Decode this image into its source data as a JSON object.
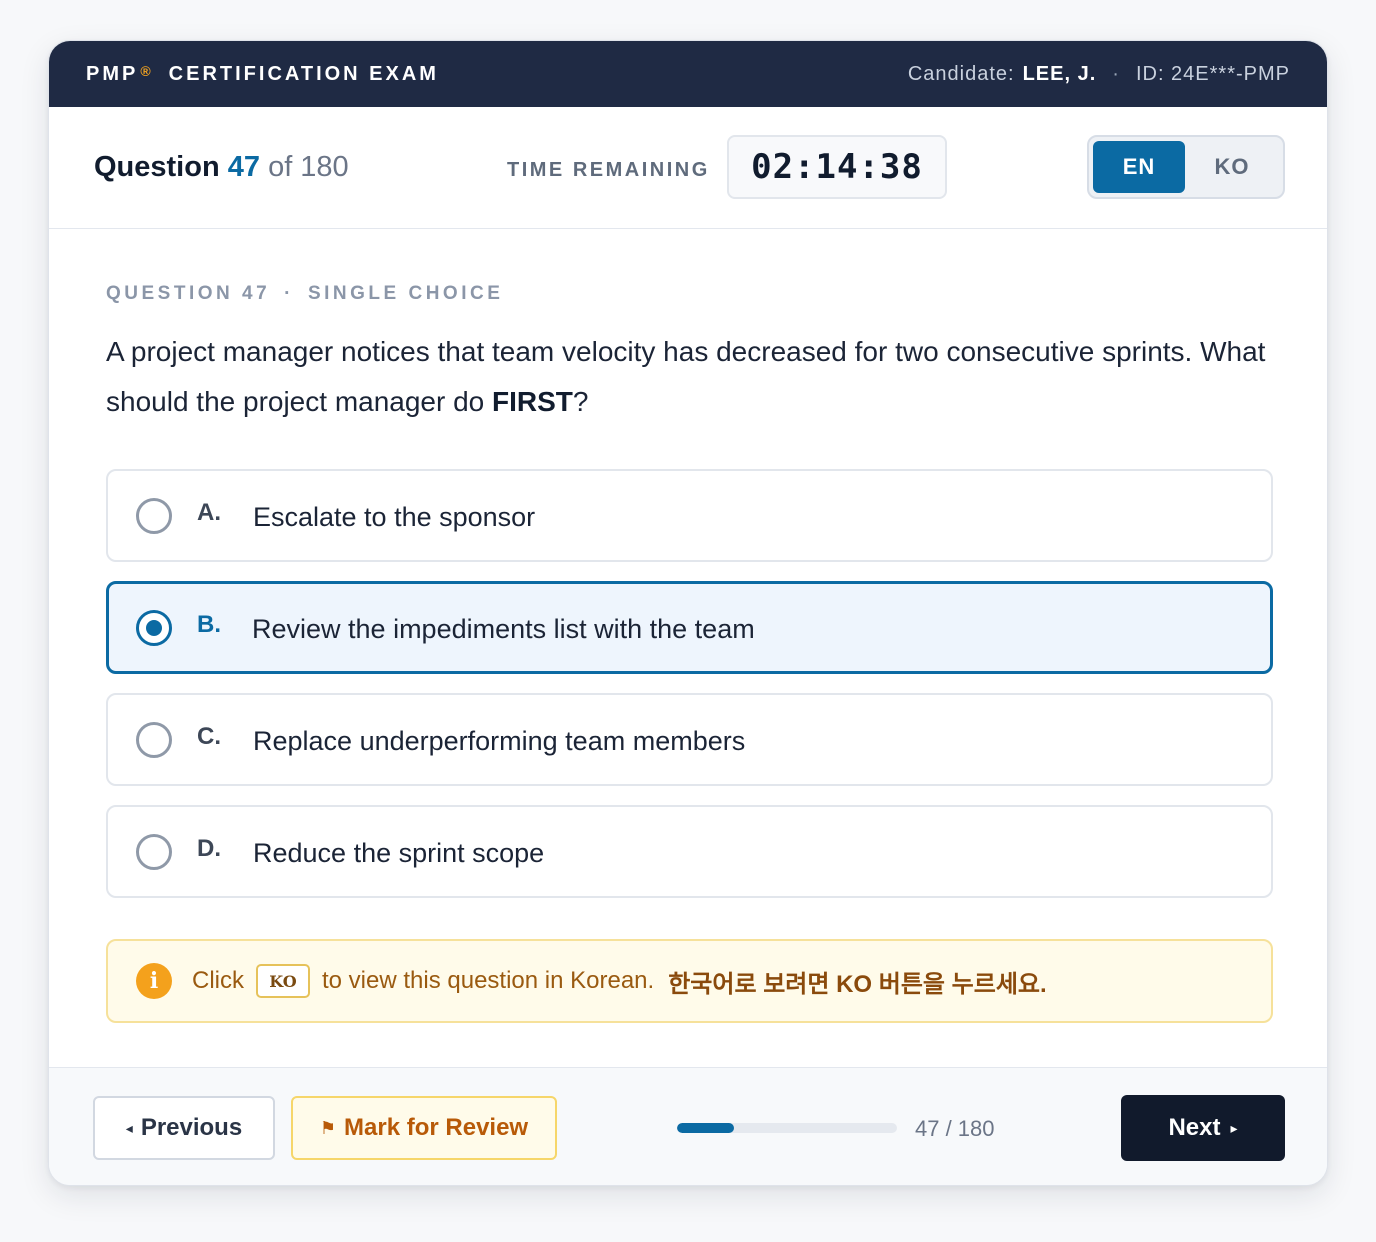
{
  "topbar": {
    "brand": "PMP",
    "brand_mark": "®",
    "title": "CERTIFICATION EXAM",
    "candidate_label": "Candidate:",
    "candidate_name": "LEE, J.",
    "separator": "·",
    "id": "ID: 24E***-PMP"
  },
  "header": {
    "question_word": "Question",
    "current": "47",
    "of_text": "of 180",
    "time_label": "TIME REMAINING",
    "timer": "02:14:38",
    "languages": [
      "EN",
      "KO"
    ],
    "selected_language": "EN"
  },
  "question": {
    "type_label": "QUESTION 47",
    "separator": "·",
    "kind": "SINGLE CHOICE",
    "text_before": "A project manager notices that team velocity has decreased for two consecutive sprints. What should the project manager do ",
    "text_emphasis": "FIRST",
    "text_after": "?"
  },
  "options": [
    {
      "letter": "A.",
      "text": "Escalate to the sponsor",
      "selected": false
    },
    {
      "letter": "B.",
      "text": "Review the impediments list with the team",
      "selected": true
    },
    {
      "letter": "C.",
      "text": "Replace underperforming team members",
      "selected": false
    },
    {
      "letter": "D.",
      "text": "Reduce the sprint scope",
      "selected": false
    }
  ],
  "notice": {
    "icon": "info-icon",
    "icon_glyph": "i",
    "click": "Click",
    "key": "KO",
    "rest": "to view this question in Korean.",
    "korean": "한국어로 보려면 KO 버튼을 누르세요."
  },
  "footer": {
    "previous_arrow": "◂",
    "previous": "Previous",
    "review_flag": "⚑",
    "review": "Mark for Review",
    "progress_fraction": 0.2611,
    "progress_text": "47 / 180",
    "next": "Next",
    "next_arrow": "▸"
  },
  "colors": {
    "topbar": "#1f2a44",
    "accent": "#0b6aa3",
    "warning": "#f4a11c",
    "next_button": "#111a2c"
  }
}
